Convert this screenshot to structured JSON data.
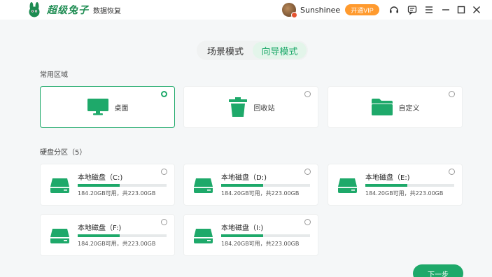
{
  "app": {
    "brand": "超级兔子",
    "subtitle": "数据恢复"
  },
  "titlebar": {
    "username": "Sunshinee",
    "vip_label": "开通VIP",
    "icons": [
      "support-icon",
      "chat-icon",
      "menu-icon",
      "minimize-icon",
      "maximize-icon",
      "close-icon"
    ]
  },
  "mode": {
    "tabs": [
      {
        "label": "场景模式",
        "active": false
      },
      {
        "label": "向导模式",
        "active": true
      }
    ]
  },
  "locations": {
    "title": "常用区域",
    "items": [
      {
        "label": "桌面",
        "icon": "monitor-icon",
        "selected": true
      },
      {
        "label": "回收站",
        "icon": "trash-icon",
        "selected": false
      },
      {
        "label": "自定义",
        "icon": "folder-icon",
        "selected": false
      }
    ]
  },
  "partitions": {
    "title": "硬盘分区（5）",
    "drives": [
      {
        "name": "本地磁盘（C:)",
        "size_text": "184.20GB可用，共223.00GB",
        "used_fraction": 0.47
      },
      {
        "name": "本地磁盘（D:)",
        "size_text": "184.20GB可用，共223.00GB",
        "used_fraction": 0.47
      },
      {
        "name": "本地磁盘（E:)",
        "size_text": "184.20GB可用，共223.00GB",
        "used_fraction": 0.47
      },
      {
        "name": "本地磁盘（F:)",
        "size_text": "184.20GB可用，共223.00GB",
        "used_fraction": 0.47
      },
      {
        "name": "本地磁盘（I:)",
        "size_text": "184.20GB可用，共223.00GB",
        "used_fraction": 0.47
      }
    ]
  },
  "footer": {
    "next_label": "下一步"
  },
  "colors": {
    "accent": "#1ea96a",
    "vip": "#ff9a2e",
    "brand": "#1e8c52"
  }
}
